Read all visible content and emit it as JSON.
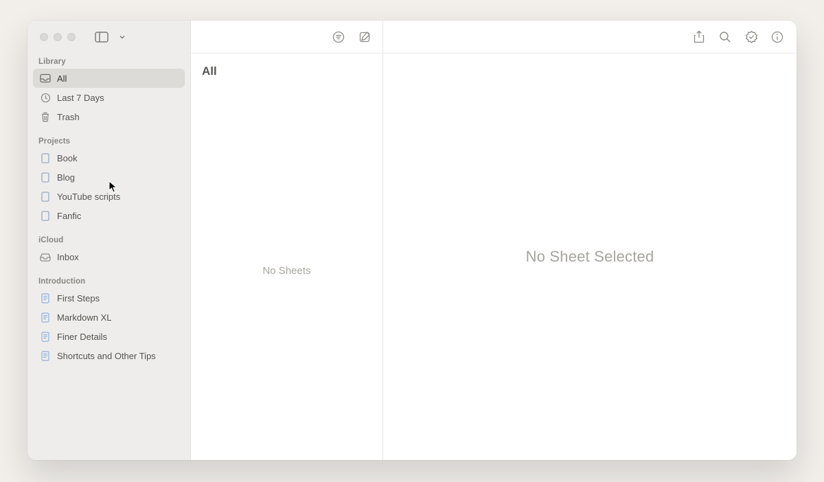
{
  "sidebar": {
    "sections": [
      {
        "title": "Library",
        "items": [
          {
            "label": "All",
            "icon": "tray-icon",
            "selected": true
          },
          {
            "label": "Last 7 Days",
            "icon": "clock-icon",
            "selected": false
          },
          {
            "label": "Trash",
            "icon": "trash-icon",
            "selected": false
          }
        ]
      },
      {
        "title": "Projects",
        "items": [
          {
            "label": "Book",
            "icon": "doc-icon",
            "selected": false
          },
          {
            "label": "Blog",
            "icon": "doc-icon",
            "selected": false
          },
          {
            "label": "YouTube scripts",
            "icon": "doc-icon",
            "selected": false
          },
          {
            "label": "Fanfic",
            "icon": "doc-icon",
            "selected": false
          }
        ]
      },
      {
        "title": "iCloud",
        "items": [
          {
            "label": "Inbox",
            "icon": "inbox-icon",
            "selected": false
          }
        ]
      },
      {
        "title": "Introduction",
        "items": [
          {
            "label": "First Steps",
            "icon": "page-icon",
            "selected": false
          },
          {
            "label": "Markdown XL",
            "icon": "page-icon",
            "selected": false
          },
          {
            "label": "Finer Details",
            "icon": "page-icon",
            "selected": false
          },
          {
            "label": "Shortcuts and Other Tips",
            "icon": "page-icon",
            "selected": false
          }
        ]
      }
    ]
  },
  "sheets": {
    "title": "All",
    "empty": "No Sheets"
  },
  "editor": {
    "empty": "No Sheet Selected"
  }
}
